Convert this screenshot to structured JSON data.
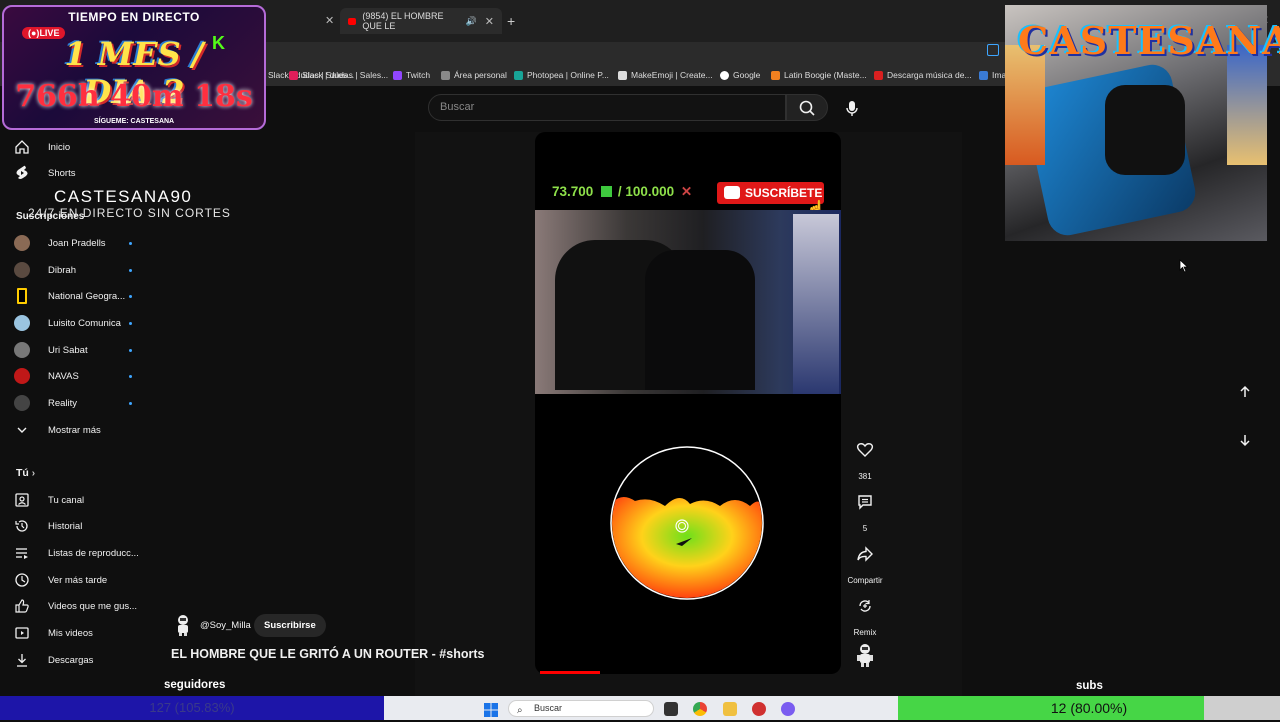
{
  "browser": {
    "tabs": [
      {
        "title": ""
      },
      {
        "title": "(9854) EL HOMBRE QUE LE"
      }
    ],
    "bookmarks": [
      "Slack | dudas | Sales...",
      "Twitch",
      "Área personal",
      "Photopea | Online P...",
      "MakeEmoji | Create...",
      "Google",
      "Latin Boogie (Maste...",
      "Descarga música de...",
      "Imag"
    ]
  },
  "youtube": {
    "search_placeholder": "Buscar",
    "sidebar": {
      "nav": [
        {
          "label": "Inicio",
          "icon": "home-icon"
        },
        {
          "label": "Shorts",
          "icon": "shorts-icon"
        }
      ],
      "subscriptions_title": "Suscripciones",
      "subscriptions": [
        {
          "label": "Joan Pradells",
          "color": "#8a6a55"
        },
        {
          "label": "Dibrah",
          "color": "#5a4a40"
        },
        {
          "label": "National Geogra...",
          "color": "#ffcc00"
        },
        {
          "label": "Luisito Comunica",
          "color": "#9ac4e0"
        },
        {
          "label": "Uri Sabat",
          "color": "#777777"
        },
        {
          "label": "NAVAS",
          "color": "#c01818"
        },
        {
          "label": "Reality",
          "color": "#444444"
        }
      ],
      "show_more": "Mostrar más",
      "you_title": "Tú",
      "you_items": [
        {
          "label": "Tu canal",
          "icon": "channel-icon"
        },
        {
          "label": "Historial",
          "icon": "history-icon"
        },
        {
          "label": "Listas de reproducc...",
          "icon": "playlist-icon"
        },
        {
          "label": "Ver más tarde",
          "icon": "clock-icon"
        },
        {
          "label": "Videos que me gus...",
          "icon": "thumb-up-icon"
        },
        {
          "label": "Mis videos",
          "icon": "video-icon"
        },
        {
          "label": "Descargas",
          "icon": "download-icon"
        }
      ]
    },
    "short": {
      "sub_goal": "73.700",
      "sub_goal_sep": "/ 100.000",
      "subscribe_overlay": "SUSCRÍBETE",
      "channel": "@Soy_Milla",
      "subscribe_button": "Suscribirse",
      "title": "EL HOMBRE QUE LE GRITÓ A UN ROUTER - #shorts",
      "likes": "381",
      "comments": "5",
      "share": "Compartir",
      "remix": "Remix"
    }
  },
  "stream_overlay": {
    "live_title": "TIEMPO EN DIRECTO",
    "live_tag": "LIVE",
    "day_counter": "1 MES / DIA 2",
    "elapsed": "766h 40m 18s",
    "follow": "SÍGUEME: CASTESANA",
    "brand_name": "CASTESANA90",
    "brand_sub": "24/7 EN DIRECTO SIN CORTES",
    "cam_logo": "CASTESANA",
    "followers_label": "seguidores",
    "followers_value": "127 (105.83%)",
    "subs_label": "subs",
    "subs_value": "12 (80.00%)",
    "subs_progress": 0.8
  },
  "taskbar": {
    "search": "Buscar"
  }
}
